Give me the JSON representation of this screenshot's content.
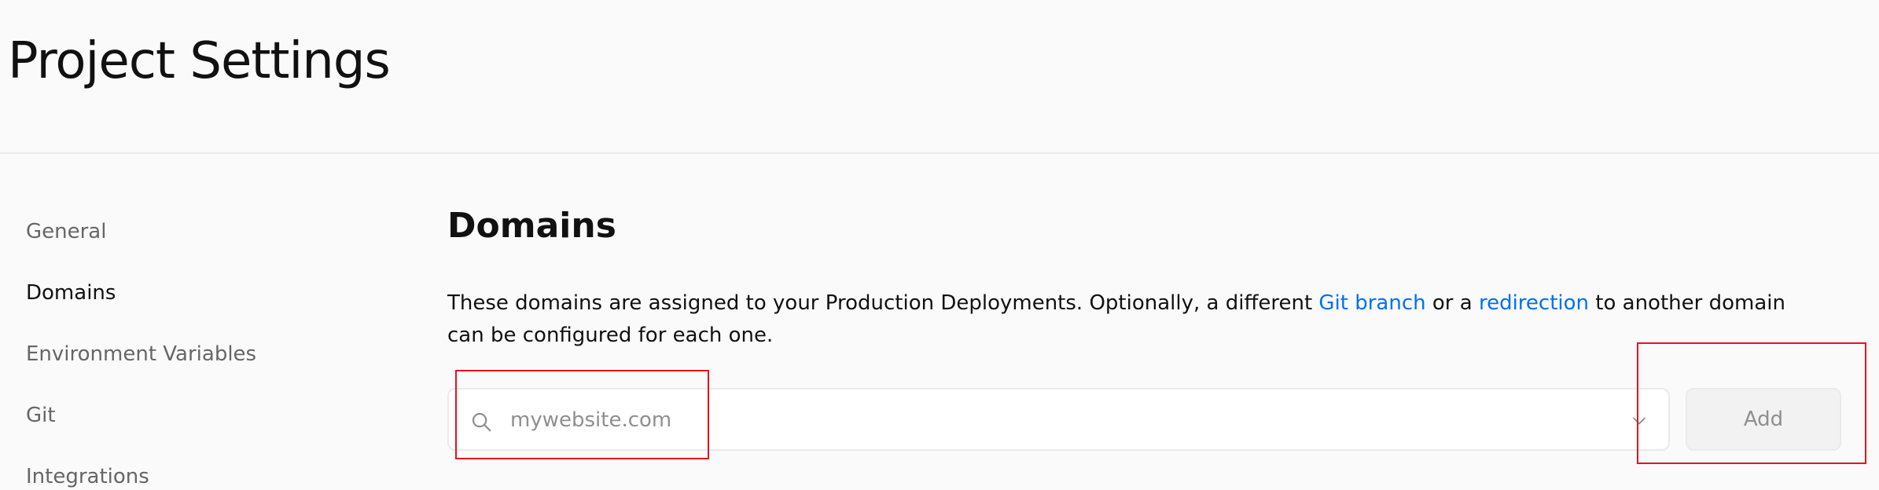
{
  "page": {
    "title": "Project Settings"
  },
  "sidebar": {
    "items": [
      {
        "label": "General",
        "active": false
      },
      {
        "label": "Domains",
        "active": true
      },
      {
        "label": "Environment Variables",
        "active": false
      },
      {
        "label": "Git",
        "active": false
      },
      {
        "label": "Integrations",
        "active": false
      }
    ]
  },
  "domains": {
    "title": "Domains",
    "description": {
      "part1": "These domains are assigned to your Production Deployments. Optionally, a different ",
      "link1": "Git branch",
      "part2": " or a ",
      "link2": "redirection",
      "part3": " to another domain can be configured for each one."
    },
    "input": {
      "value": "",
      "placeholder": "mywebsite.com",
      "leading_icon": "search-icon",
      "trailing_icon": "chevron-down-icon"
    },
    "add_button_label": "Add"
  },
  "colors": {
    "background": "#fafafa",
    "text": "#111111",
    "muted_text": "#666666",
    "link": "#0070f3",
    "placeholder": "#8f8f8f",
    "highlight": "#e5131f"
  }
}
